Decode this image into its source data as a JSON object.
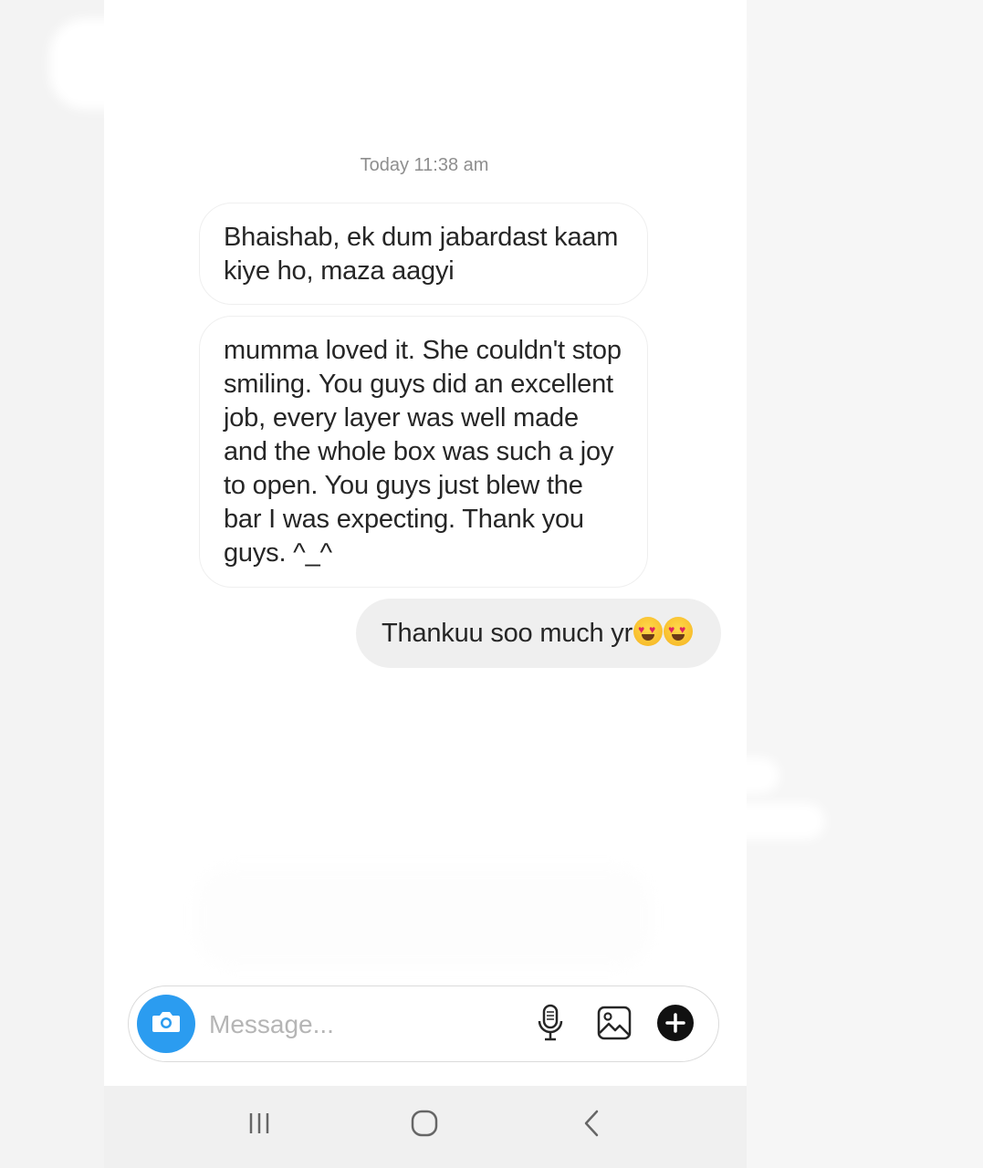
{
  "thread": {
    "timestamp": "Today 11:38 am",
    "messages": [
      {
        "direction": "incoming",
        "text": "Bhaishab, ek dum jabardast kaam kiye ho, maza aagyi"
      },
      {
        "direction": "incoming",
        "text": "mumma loved it. She couldn't stop smiling. You guys did an excellent job, every layer was well made and the whole box was such a joy to open. You guys just blew the bar I was expecting. Thank you guys. ^_^"
      },
      {
        "direction": "outgoing",
        "text": "Thankuu soo much yr",
        "emoji": [
          "smiling-face-with-heart-eyes",
          "smiling-face-with-heart-eyes"
        ]
      }
    ]
  },
  "composer": {
    "placeholder": "Message...",
    "value": "",
    "icons": [
      "camera-icon",
      "microphone-icon",
      "gallery-icon",
      "plus-icon"
    ],
    "camera_color": "#2b9cf0"
  },
  "navigation_bar": {
    "buttons": [
      "recent-apps-icon",
      "home-icon",
      "back-icon"
    ]
  }
}
